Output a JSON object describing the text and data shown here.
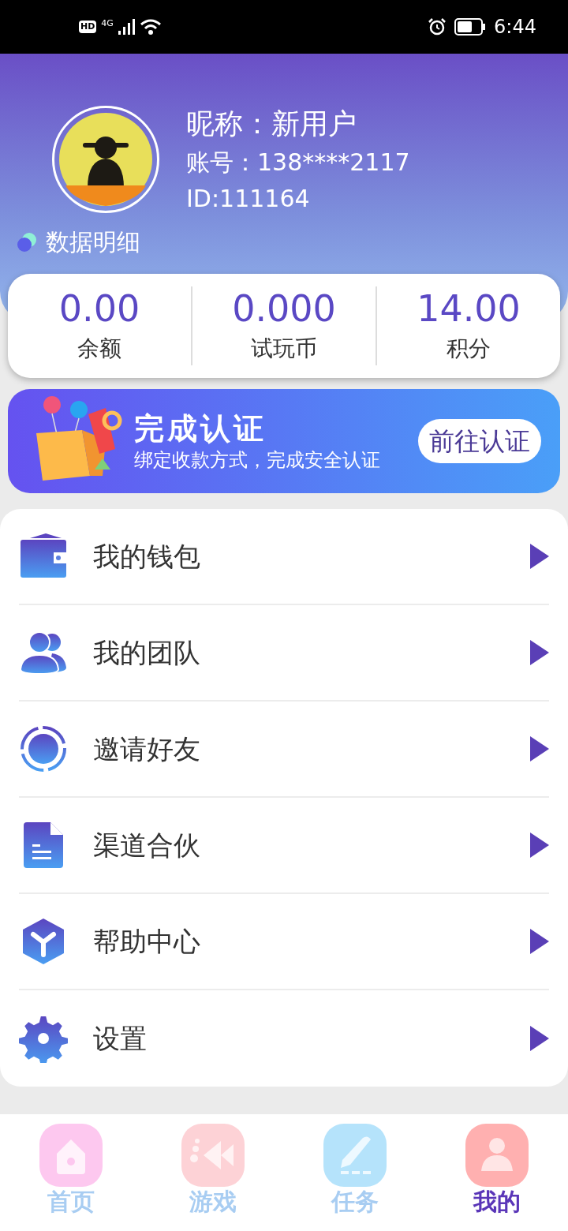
{
  "status_bar": {
    "hd": "HD",
    "network": "4G",
    "time": "6:44"
  },
  "profile": {
    "nickname": "昵称：新用户",
    "account": "账号：138****2117",
    "id": "ID:111164",
    "details_link": "数据明细"
  },
  "stats": [
    {
      "value": "0.00",
      "label": "余额"
    },
    {
      "value": "0.000",
      "label": "试玩币"
    },
    {
      "value": "14.00",
      "label": "积分"
    }
  ],
  "banner": {
    "title": "完成认证",
    "subtitle": "绑定收款方式，完成安全认证",
    "button": "前往认证"
  },
  "menu": [
    {
      "kind": "wallet",
      "label": "我的钱包"
    },
    {
      "kind": "team",
      "label": "我的团队"
    },
    {
      "kind": "invite",
      "label": "邀请好友"
    },
    {
      "kind": "document",
      "label": "渠道合伙"
    },
    {
      "kind": "help",
      "label": "帮助中心"
    },
    {
      "kind": "settings",
      "label": "设置"
    }
  ],
  "tabs": [
    {
      "kind": "home",
      "label": "首页",
      "selected": false
    },
    {
      "kind": "games",
      "label": "游戏",
      "selected": false
    },
    {
      "kind": "tasks",
      "label": "任务",
      "selected": false
    },
    {
      "kind": "profile",
      "label": "我的",
      "selected": true
    }
  ]
}
